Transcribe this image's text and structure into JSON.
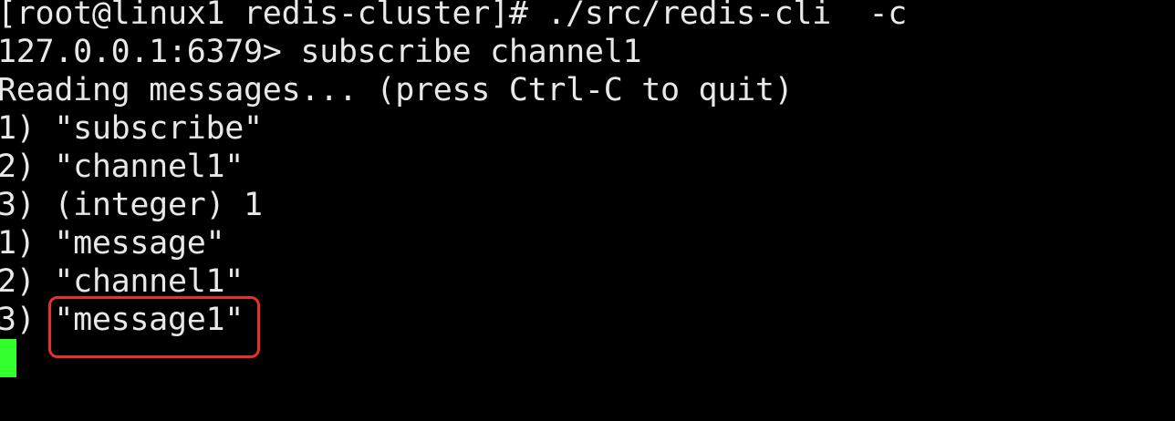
{
  "terminal": {
    "prompt_line": "[root@linux1 redis-cluster]# ./src/redis-cli  -c",
    "lines": [
      "127.0.0.1:6379> subscribe channel1",
      "Reading messages... (press Ctrl-C to quit)",
      "1) \"subscribe\"",
      "2) \"channel1\"",
      "3) (integer) 1",
      "1) \"message\"",
      "2) \"channel1\"",
      "3) \"message1\""
    ]
  },
  "colors": {
    "background": "#000000",
    "text": "#e8e8e8",
    "cursor": "#33ff2e",
    "highlight_border": "#e53226"
  }
}
